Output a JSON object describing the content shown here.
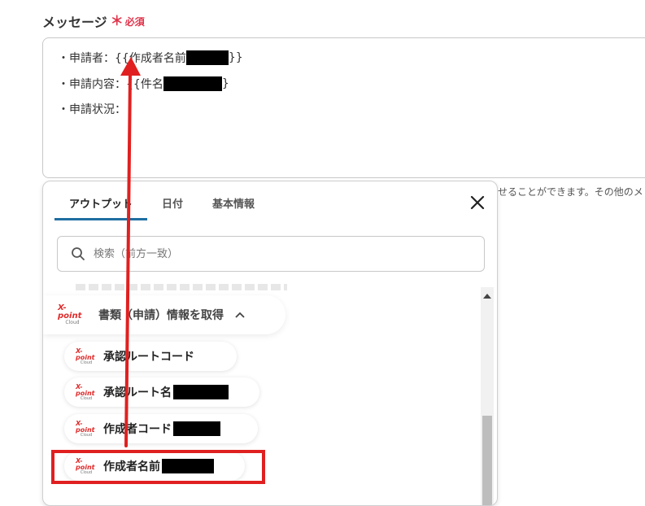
{
  "field": {
    "label": "メッセージ",
    "required_mark": "＊",
    "required_text": "必須"
  },
  "message": {
    "line1_prefix": "・申請者：{{作成者名前",
    "line1_suffix": "}}",
    "line2_prefix": "・申請内容：{{件名",
    "line2_suffix": "}",
    "line3": "・申請状況："
  },
  "helper_text": "せることができます。その他のメ",
  "panel": {
    "tabs": [
      "アウトプット",
      "日付",
      "基本情報"
    ],
    "search_placeholder": "検索（前方一致）",
    "group_logo": {
      "brand": "X-point",
      "sub": "Cloud"
    },
    "group_title": "書類（申請）情報を取得",
    "items": [
      {
        "label": "承認ルートコード"
      },
      {
        "label": "承認ルート名"
      },
      {
        "label": "作成者コード"
      },
      {
        "label": "作成者名前"
      }
    ]
  },
  "colors": {
    "accent": "#1e6ea0",
    "required": "#e0334a",
    "highlight": "#e02020"
  }
}
